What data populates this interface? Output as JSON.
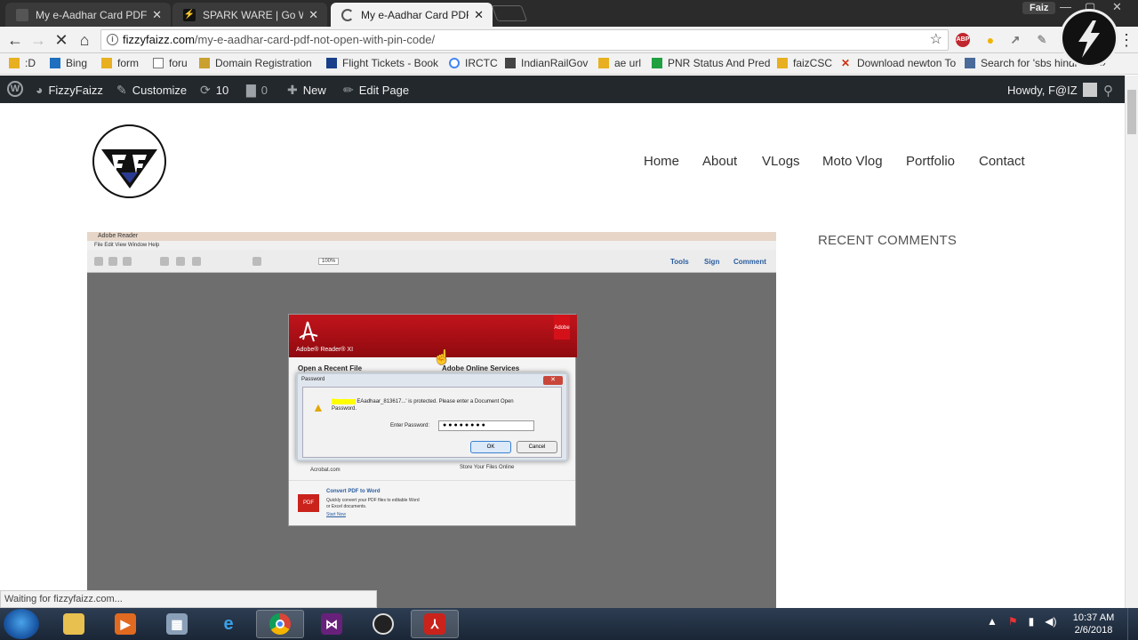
{
  "browser": {
    "tabs": [
      {
        "title": "My e-Aadhar Card PDF N",
        "close": "✕",
        "active": false
      },
      {
        "title": "SPARK WARE | Go With T",
        "close": "✕",
        "active": false
      },
      {
        "title": "My e-Aadhar Card PDF N",
        "close": "✕",
        "active": true
      }
    ],
    "profile_name": "Faiz",
    "url_domain": "fizzyfaizz.com",
    "url_path": "/my-e-aadhar-card-pdf-not-open-with-pin-code/",
    "bookmarks": [
      {
        "label": ":D"
      },
      {
        "label": "Bing"
      },
      {
        "label": "form"
      },
      {
        "label": "foru"
      },
      {
        "label": "Domain Registration"
      },
      {
        "label": "Flight Tickets - Book"
      },
      {
        "label": "IRCTC"
      },
      {
        "label": "IndianRailGov"
      },
      {
        "label": "ae url"
      },
      {
        "label": "PNR Status And Pred"
      },
      {
        "label": "faizCSC"
      },
      {
        "label": "Download newton To"
      },
      {
        "label": "Search for 'sbs hindi"
      }
    ],
    "status_text": "Waiting for fizzyfaizz.com..."
  },
  "adminbar": {
    "site_name": "FizzyFaizz",
    "customize": "Customize",
    "updates_count": "10",
    "comments_count": "0",
    "new_label": "New",
    "edit_label": "Edit Page",
    "howdy": "Howdy, F@IZ"
  },
  "site": {
    "menu": [
      "Home",
      "About",
      "VLogs",
      "Moto Vlog",
      "Portfolio",
      "Contact"
    ],
    "sidebar_heading": "RECENT COMMENTS"
  },
  "embedded": {
    "app_title": "Adobe Reader",
    "menu_items": "File  Edit  View  Window  Help",
    "zoom": "100%",
    "tools": "Tools",
    "sign": "Sign",
    "comment": "Comment",
    "brand": "Adobe® Reader® XI",
    "adobe_badge": "Adobe",
    "open_recent": "Open a Recent File",
    "online_services": "Adobe Online Services",
    "password_title": "Password",
    "redacted": "EAadhaar",
    "message": "EAadhaar_813617...' is protected. Please enter a Document Open Password.",
    "enter_password": "Enter Password:",
    "password_mask": "●●●●●●●●",
    "ok": "OK",
    "cancel": "Cancel",
    "acrobat": "Acrobat.com",
    "store_files": "Store Your Files Online",
    "convert_title": "Convert PDF to Word",
    "convert_desc": "Quickly convert your PDF files to editable Word or Excel documents.",
    "start_now": "Start Now"
  },
  "taskbar": {
    "time": "10:37 AM",
    "date": "2/6/2018"
  }
}
